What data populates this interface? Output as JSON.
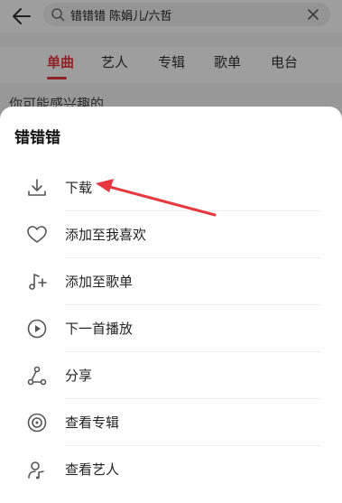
{
  "search": {
    "query": "错错错 陈娟儿/六哲"
  },
  "tabs": [
    {
      "label": "单曲",
      "active": true
    },
    {
      "label": "艺人",
      "active": false
    },
    {
      "label": "专辑",
      "active": false
    },
    {
      "label": "歌单",
      "active": false
    },
    {
      "label": "电台",
      "active": false
    }
  ],
  "section_hint": "你可能感兴趣的",
  "sheet": {
    "title": "错错错",
    "items": [
      {
        "label": "下载",
        "icon": "download-icon"
      },
      {
        "label": "添加至我喜欢",
        "icon": "heart-icon"
      },
      {
        "label": "添加至歌单",
        "icon": "add-to-playlist-icon"
      },
      {
        "label": "下一首播放",
        "icon": "play-next-icon"
      },
      {
        "label": "分享",
        "icon": "share-icon"
      },
      {
        "label": "查看专辑",
        "icon": "album-icon"
      },
      {
        "label": "查看艺人",
        "icon": "artist-icon"
      }
    ]
  },
  "colors": {
    "accent": "#e8383d",
    "annotation": "#e8383d"
  }
}
